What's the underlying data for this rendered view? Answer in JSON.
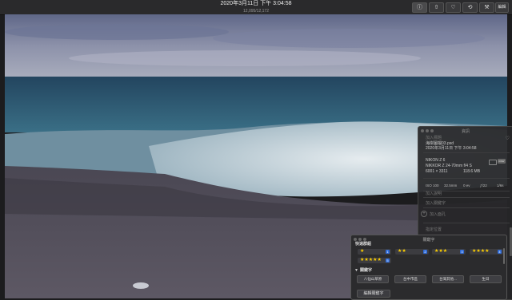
{
  "window": {
    "title": "2020年3月11日 下午 3:04:58",
    "subtitle": "12,095/12,172"
  },
  "toolbar": {
    "info_icon": "info-icon",
    "share_icon": "share-icon",
    "favorite_icon": "heart-icon",
    "rotate_icon": "rotate-icon",
    "enhance_icon": "magic-wand-icon",
    "edit_label": "編輯"
  },
  "info_panel": {
    "header": "資訊",
    "add_title": "加入標題",
    "filename": "海岸圖檔03.psd",
    "date": "2020年3月11日",
    "time": "下午 3:04:58",
    "camera": "NIKON Z 6",
    "lens": "NIKKOR Z 24-70mm f/4 S",
    "dimensions": "6001 × 3311",
    "filesize": "118.6 MB",
    "raw_badge": "RAW",
    "iso": "ISO 100",
    "focal": "32.5mm",
    "ev": "0 ev",
    "aperture": "ƒ/22",
    "shutter": "1/6s",
    "add_caption": "加入說明",
    "add_keyword": "加入關鍵字",
    "add_face": "加入面孔",
    "location_label": "指定位置"
  },
  "keywords_panel": {
    "header": "關鍵字",
    "title": "快速群組",
    "ratings": [
      {
        "stars": "★",
        "key": "1"
      },
      {
        "stars": "★★",
        "key": "2"
      },
      {
        "stars": "★★★",
        "key": "3"
      },
      {
        "stars": "★★★★",
        "key": "4"
      },
      {
        "stars": "★★★★★",
        "key": "5"
      }
    ],
    "section_label": "關鍵字",
    "tags": [
      "八仙山草原",
      "台中市區",
      "台灣其他...",
      "生日"
    ],
    "edit_button": "編輯關鍵字"
  }
}
